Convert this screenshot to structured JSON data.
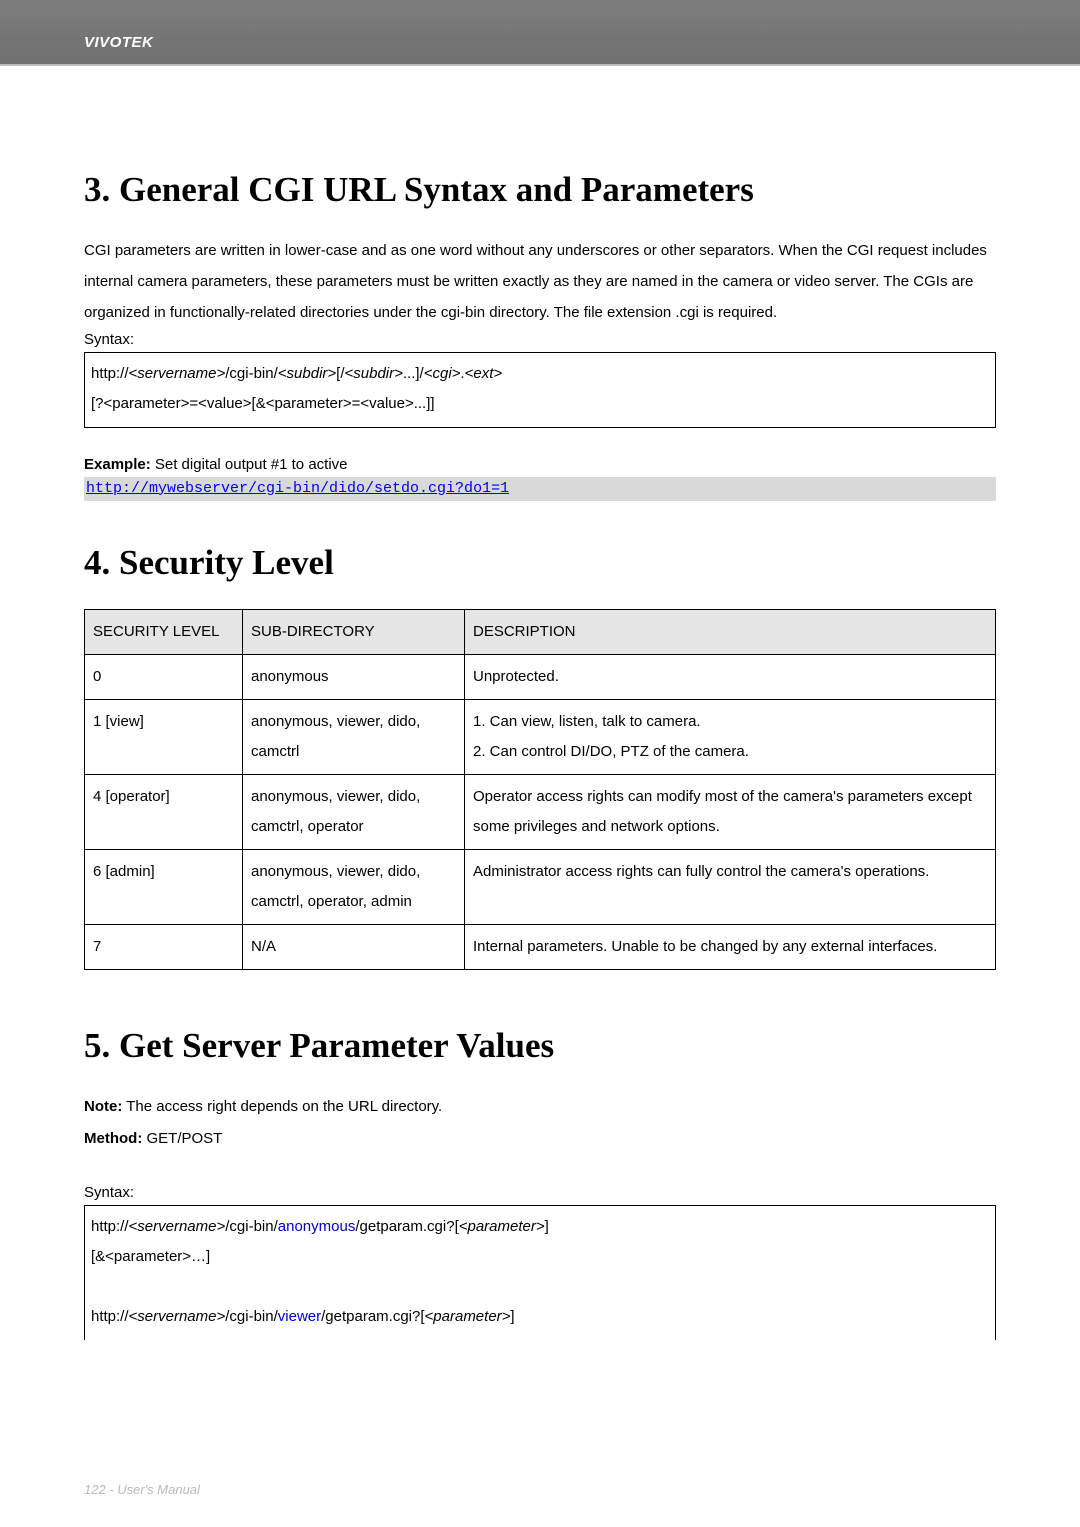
{
  "header": {
    "brand": "VIVOTEK"
  },
  "section3": {
    "title": "3. General CGI URL Syntax and Parameters",
    "paragraph": "CGI parameters are written in lower-case and as one word without any underscores or other separators. When the CGI request includes internal camera parameters, these parameters must be written exactly as they are named in the camera or video server. The CGIs are organized in functionally-related directories under the cgi-bin directory. The file extension .cgi is required.",
    "syntax_label": "Syntax:",
    "syntax_line1_a": "http://",
    "syntax_line1_b": "<servername>",
    "syntax_line1_c": "/cgi-bin/",
    "syntax_line1_d": "<subdir>",
    "syntax_line1_e": "[/",
    "syntax_line1_f": "<subdir>",
    "syntax_line1_g": "...]/",
    "syntax_line1_h": "<cgi>",
    "syntax_line1_i": ".",
    "syntax_line1_j": "<ext>",
    "syntax_line2": "[?<parameter>=<value>[&<parameter>=<value>...]]",
    "example_label": "Example:",
    "example_text": " Set digital output #1 to active",
    "example_link": "http://mywebserver/cgi-bin/dido/setdo.cgi?do1=1"
  },
  "section4": {
    "title": "4. Security Level",
    "headers": {
      "c1": "SECURITY LEVEL",
      "c2": "SUB-DIRECTORY",
      "c3": "DESCRIPTION"
    },
    "rows": [
      {
        "level": "0",
        "subdir": "anonymous",
        "desc": "Unprotected."
      },
      {
        "level": "1 [view]",
        "subdir": "anonymous, viewer, dido, camctrl",
        "desc": "1. Can view, listen, talk to camera.\n2. Can control DI/DO, PTZ of the camera."
      },
      {
        "level": "4 [operator]",
        "subdir": "anonymous, viewer, dido, camctrl, operator",
        "desc": "Operator access rights can modify most of the camera's parameters except some privileges and network options."
      },
      {
        "level": "6 [admin]",
        "subdir": "anonymous, viewer, dido, camctrl, operator, admin",
        "desc": "Administrator access rights can fully control the camera's operations."
      },
      {
        "level": "7",
        "subdir": "N/A",
        "desc": "Internal parameters. Unable to be changed by any external interfaces."
      }
    ]
  },
  "section5": {
    "title": "5. Get Server Parameter Values",
    "note_label": "Note:",
    "note_text": " The access right depends on the URL directory.",
    "method_label": "Method:",
    "method_text": " GET/POST",
    "syntax_label": "Syntax:",
    "line1_a": "http://",
    "line1_b": "<servername>",
    "line1_c": "/cgi-bin/",
    "line1_d": "anonymous",
    "line1_e": "/getparam.cgi?[",
    "line1_f": "<parameter>",
    "line1_g": "]",
    "line2": "[&<parameter>…]",
    "line3_a": "http://",
    "line3_b": "<servername>",
    "line3_c": "/cgi-bin/",
    "line3_d": "viewer",
    "line3_e": "/getparam.cgi?[",
    "line3_f": "<parameter>",
    "line3_g": "]"
  },
  "footer": {
    "text": "122 - User's Manual"
  }
}
